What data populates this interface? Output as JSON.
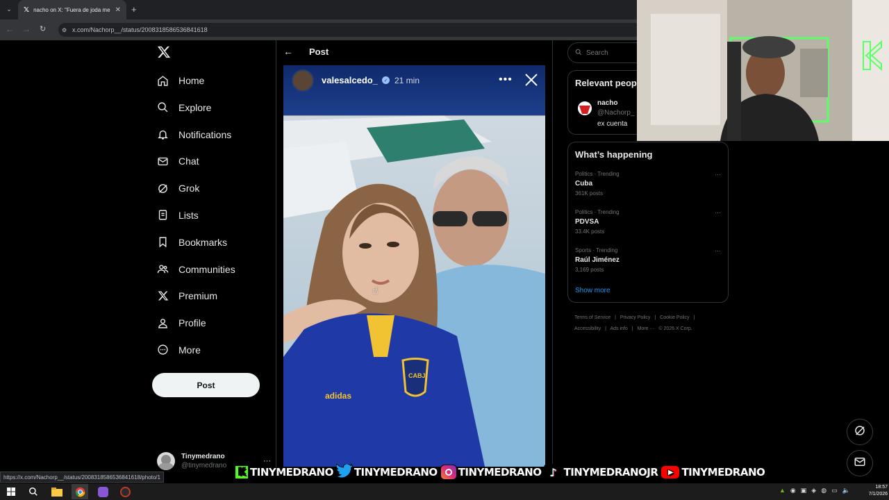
{
  "browser": {
    "tab_title": "nacho on X: \"Fuera de joda me",
    "url": "x.com/Nachorp__/status/2008318586536841618",
    "status_url": "https://x.com/Nachorp__/status/2008318586536841618/photo/1"
  },
  "nav": {
    "items": [
      {
        "label": "Home",
        "icon": "home-icon"
      },
      {
        "label": "Explore",
        "icon": "search-icon"
      },
      {
        "label": "Notifications",
        "icon": "bell-icon"
      },
      {
        "label": "Chat",
        "icon": "mail-icon"
      },
      {
        "label": "Grok",
        "icon": "grok-icon"
      },
      {
        "label": "Lists",
        "icon": "list-icon"
      },
      {
        "label": "Bookmarks",
        "icon": "bookmark-icon"
      },
      {
        "label": "Communities",
        "icon": "people-icon"
      },
      {
        "label": "Premium",
        "icon": "x-logo-icon"
      },
      {
        "label": "Profile",
        "icon": "person-icon"
      },
      {
        "label": "More",
        "icon": "more-circle-icon"
      }
    ],
    "post_label": "Post"
  },
  "account": {
    "name": "Tinymedrano",
    "handle": "@tinymedrano"
  },
  "center": {
    "header_title": "Post",
    "story_user": "valesalcedo_",
    "story_time": "21 min"
  },
  "right": {
    "search_placeholder": "Search",
    "relevant_title": "Relevant peop",
    "relevant_name": "nacho",
    "relevant_handle": "@Nachorp_",
    "relevant_bio": "ex cuenta",
    "happening_title": "What’s happening",
    "trends": [
      {
        "meta": "Politics · Trending",
        "name": "Cuba",
        "count": "361K posts"
      },
      {
        "meta": "Politics · Trending",
        "name": "PDVSA",
        "count": "33.4K posts"
      },
      {
        "meta": "Sports · Trending",
        "name": "Raúl Jiménez",
        "count": "3,169 posts"
      }
    ],
    "show_more": "Show more",
    "footer": [
      "Terms of Service",
      "|",
      "Privacy Policy",
      "|",
      "Cookie Policy",
      "|",
      "Accessibility",
      "|",
      "Ads info",
      "|",
      "More ···",
      "© 2026 X Corp."
    ]
  },
  "social": [
    {
      "label": "TINYMEDRANO",
      "icon": "kick-icon",
      "color": "#53fc18"
    },
    {
      "label": "TINYMEDRANO",
      "icon": "twitter-bird-icon",
      "color": "#1da1f2"
    },
    {
      "label": "TINYMEDRANO",
      "icon": "instagram-icon",
      "color": "#e1306c"
    },
    {
      "label": "TINYMEDRANOJR",
      "icon": "tiktok-icon",
      "color": "#000000"
    },
    {
      "label": "TINYMEDRANO",
      "icon": "youtube-icon",
      "color": "#ff0000"
    }
  ],
  "taskbar": {
    "time": "18:57",
    "date": "7/1/2026"
  }
}
